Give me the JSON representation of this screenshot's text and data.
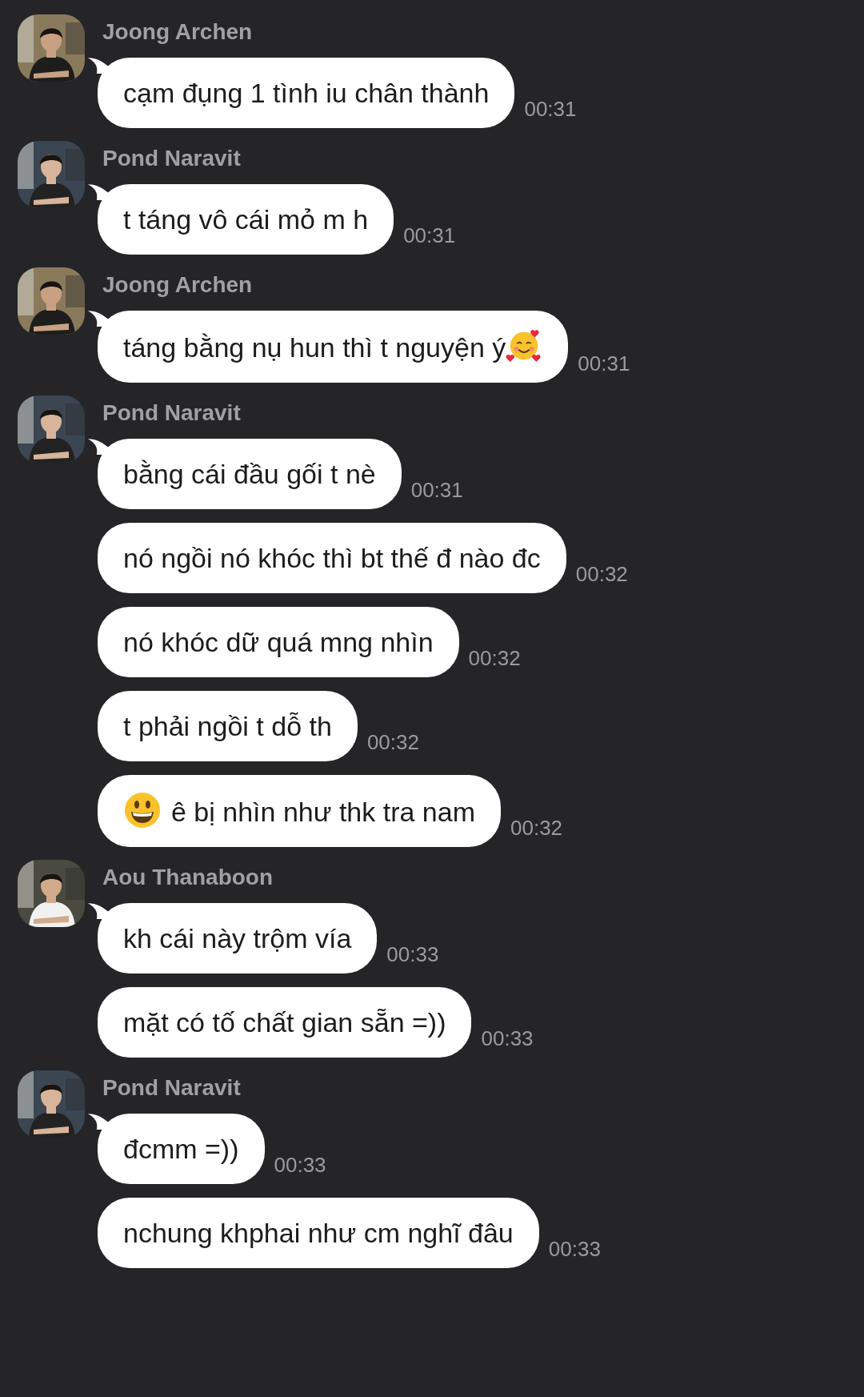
{
  "groups": [
    {
      "sender": "Joong Archen",
      "messages": [
        {
          "kind": "plain",
          "text": "cạm đụng 1 tình iu chân thành",
          "time": "00:31"
        }
      ]
    },
    {
      "sender": "Pond Naravit",
      "messages": [
        {
          "kind": "plain",
          "text": "t táng vô cái mỏ m h",
          "time": "00:31"
        }
      ]
    },
    {
      "sender": "Joong Archen",
      "messages": [
        {
          "kind": "emoji_end",
          "text": "táng bằng nụ hun thì t nguyện ý",
          "time": "00:31"
        }
      ]
    },
    {
      "sender": "Pond Naravit",
      "messages": [
        {
          "kind": "plain",
          "text": "bằng cái đầu gối t nè",
          "time": "00:31"
        },
        {
          "kind": "plain",
          "text": "nó ngồi nó khóc thì bt thế đ nào đc",
          "time": "00:32"
        },
        {
          "kind": "plain",
          "text": "nó khóc dữ quá mng nhìn",
          "time": "00:32"
        },
        {
          "kind": "plain",
          "text": "t phải ngồi t dỗ th",
          "time": "00:32"
        },
        {
          "kind": "emoji_start",
          "text": "ê bị nhìn như thk tra nam",
          "time": "00:32"
        }
      ]
    },
    {
      "sender": "Aou Thanaboon",
      "messages": [
        {
          "kind": "plain",
          "text": "kh cái này trộm vía",
          "time": "00:33"
        },
        {
          "kind": "plain",
          "text": "mặt có tố chất gian sẵn =))",
          "time": "00:33"
        }
      ]
    },
    {
      "sender": "Pond Naravit",
      "messages": [
        {
          "kind": "plain",
          "text": "đcmm =))",
          "time": "00:33"
        },
        {
          "kind": "plain",
          "text": "nchung khphai như cm nghĩ đâu",
          "time": "00:33"
        }
      ]
    }
  ]
}
